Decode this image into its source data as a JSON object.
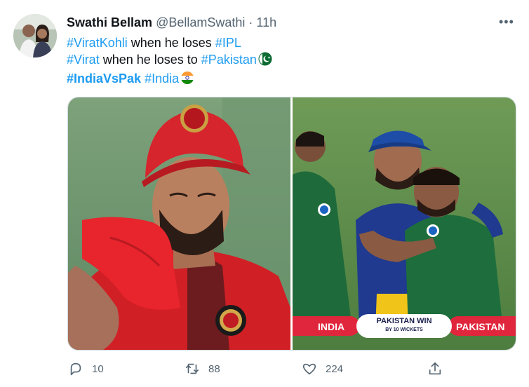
{
  "tweet": {
    "author_name": "Swathi Bellam",
    "handle": "@BellamSwathi",
    "separator": "·",
    "time": "11h",
    "more_icon": "more-horizontal-icon",
    "line1": {
      "tag1": "#ViratKohli",
      "text1": " when he loses ",
      "tag2": "#IPL"
    },
    "line2": {
      "tag1": "#Virat",
      "text1": " when he loses to ",
      "tag2": "#Pakistan",
      "flag_icon": "pakistan-flag-icon"
    },
    "line3": {
      "tag1": "#IndiaVsPak",
      "tag2": "#India",
      "flag_icon": "india-flag-icon"
    }
  },
  "media": {
    "score_banner": {
      "left_team": "INDIA",
      "result": "PAKISTAN WIN",
      "detail": "BY 10 WICKETS",
      "right_team": "PAKISTAN"
    }
  },
  "actions": {
    "replies": "10",
    "retweets": "88",
    "likes": "224",
    "reply_icon": "reply-icon",
    "retweet_icon": "retweet-icon",
    "like_icon": "heart-icon",
    "share_icon": "share-icon"
  },
  "colors": {
    "link": "#1d9bf0",
    "text": "#0f1419",
    "muted": "#536471",
    "banner_red": "#e0263c"
  }
}
